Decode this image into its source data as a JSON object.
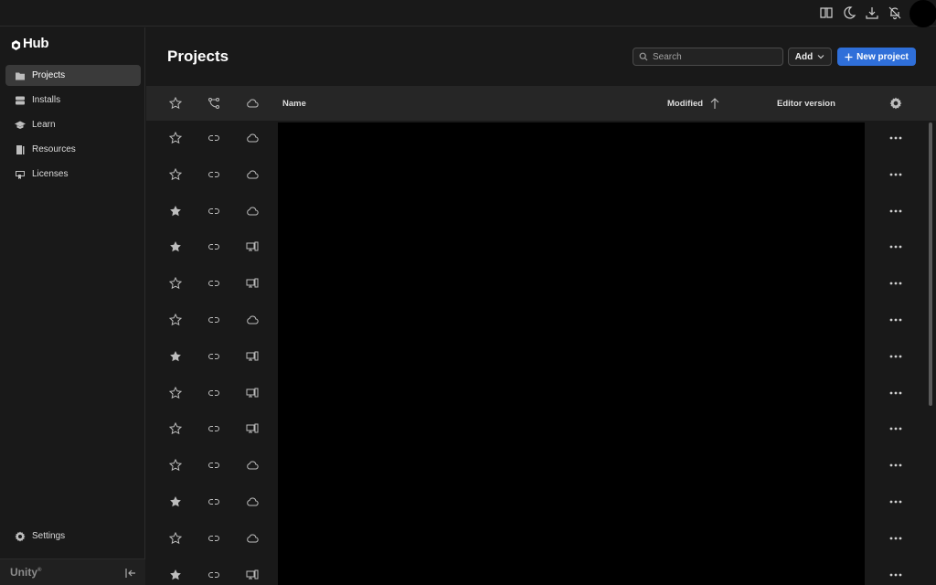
{
  "app": {
    "brand": "Hub",
    "footer_logo": "Unity"
  },
  "topbar": {
    "icons": [
      "book-icon",
      "moon-icon",
      "download-icon",
      "notifications-off-icon"
    ]
  },
  "sidebar": {
    "items": [
      {
        "label": "Projects",
        "icon": "folder-icon",
        "active": true
      },
      {
        "label": "Installs",
        "icon": "server-icon",
        "active": false
      },
      {
        "label": "Learn",
        "icon": "graduation-cap-icon",
        "active": false
      },
      {
        "label": "Resources",
        "icon": "book-stack-icon",
        "active": false
      },
      {
        "label": "Licenses",
        "icon": "license-icon",
        "active": false
      }
    ],
    "settings_label": "Settings"
  },
  "main": {
    "title": "Projects",
    "search": {
      "placeholder": "Search",
      "value": ""
    },
    "add_label": "Add",
    "new_project_label": "New project",
    "columns": {
      "name": "Name",
      "modified": "Modified",
      "editor_version": "Editor version"
    },
    "rows": [
      {
        "favorite": false,
        "location": "cloud"
      },
      {
        "favorite": false,
        "location": "cloud"
      },
      {
        "favorite": true,
        "location": "cloud"
      },
      {
        "favorite": true,
        "location": "local"
      },
      {
        "favorite": false,
        "location": "local"
      },
      {
        "favorite": false,
        "location": "cloud"
      },
      {
        "favorite": true,
        "location": "local"
      },
      {
        "favorite": false,
        "location": "local"
      },
      {
        "favorite": false,
        "location": "local"
      },
      {
        "favorite": false,
        "location": "cloud"
      },
      {
        "favorite": true,
        "location": "cloud"
      },
      {
        "favorite": false,
        "location": "cloud"
      },
      {
        "favorite": true,
        "location": "local"
      }
    ]
  }
}
